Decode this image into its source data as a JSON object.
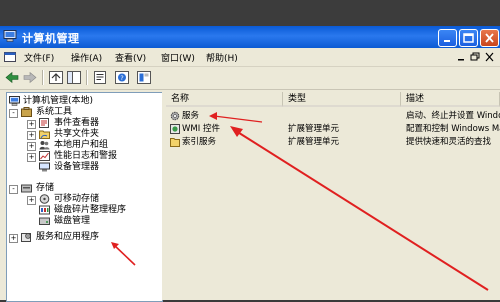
{
  "window": {
    "title": "计算机管理",
    "accent": "#0a5bd6",
    "close_color": "#d9522a"
  },
  "menubar": {
    "items": [
      "文件(F)",
      "操作(A)",
      "查看(V)",
      "窗口(W)",
      "帮助(H)"
    ]
  },
  "toolbar": {
    "buttons": [
      "back-icon",
      "forward-icon",
      "up-folder-icon",
      "properties-icon",
      "print-icon",
      "help-icon",
      "export-icon"
    ]
  },
  "tree": {
    "root": "计算机管理(本地)",
    "items": [
      {
        "label": "系统工具",
        "icon": "tools-icon",
        "expander": "-"
      },
      {
        "label": "事件查看器",
        "icon": "event-viewer-icon",
        "expander": "+"
      },
      {
        "label": "共享文件夹",
        "icon": "shared-folder-icon",
        "expander": "+"
      },
      {
        "label": "本地用户和组",
        "icon": "users-icon",
        "expander": "+"
      },
      {
        "label": "性能日志和警报",
        "icon": "performance-icon",
        "expander": "+"
      },
      {
        "label": "设备管理器",
        "icon": "device-manager-icon",
        "expander": ""
      },
      {
        "label": "存储",
        "icon": "storage-icon",
        "expander": "-"
      },
      {
        "label": "可移动存储",
        "icon": "removable-storage-icon",
        "expander": "+"
      },
      {
        "label": "磁盘碎片整理程序",
        "icon": "defrag-icon",
        "expander": ""
      },
      {
        "label": "磁盘管理",
        "icon": "disk-management-icon",
        "expander": ""
      },
      {
        "label": "服务和应用程序",
        "icon": "services-apps-icon",
        "expander": "+"
      }
    ]
  },
  "list": {
    "columns": [
      "名称",
      "类型",
      "描述"
    ],
    "rows": [
      {
        "name": "服务",
        "type": "",
        "desc": "启动、终止并设置 Windows",
        "icon": "gear-icon"
      },
      {
        "name": "WMI 控件",
        "type": "扩展管理单元",
        "desc": "配置和控制 Windows Manage",
        "icon": "wmi-icon"
      },
      {
        "name": "索引服务",
        "type": "扩展管理单元",
        "desc": "提供快速和灵活的查找",
        "icon": "index-icon"
      }
    ]
  },
  "annotation": {
    "arrow_color": "#e02020"
  }
}
